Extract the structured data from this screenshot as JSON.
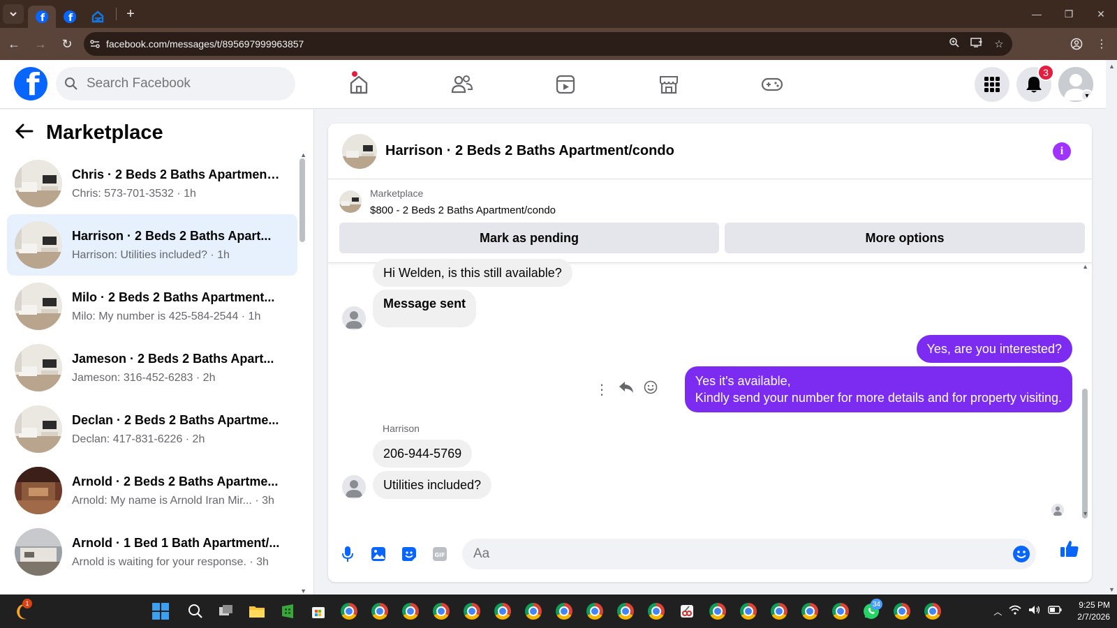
{
  "browser": {
    "tabs": [
      {
        "name": "facebook-tab-1",
        "active": true
      },
      {
        "name": "facebook-tab-2",
        "active": false
      },
      {
        "name": "zillow-tab",
        "active": false
      }
    ],
    "url": "facebook.com/messages/t/895697999963857"
  },
  "fb_header": {
    "search_placeholder": "Search Facebook",
    "notification_count": "3"
  },
  "left_panel": {
    "title": "Marketplace",
    "conversations": [
      {
        "name": "Chris · 2 Beds 2 Baths Apartment...",
        "preview": "Chris: 573-701-3532 · 1h",
        "active": false
      },
      {
        "name": "Harrison · 2 Beds 2 Baths Apart...",
        "preview": "Harrison: Utilities included? · 1h",
        "active": true
      },
      {
        "name": "Milo · 2 Beds 2 Baths Apartment...",
        "preview": "Milo: My number is 425-584-2544 · 1h",
        "active": false
      },
      {
        "name": "Jameson · 2 Beds 2 Baths Apart...",
        "preview": "Jameson: 316-452-6283 · 2h",
        "active": false
      },
      {
        "name": "Declan · 2 Beds 2 Baths Apartme...",
        "preview": "Declan: 417-831-6226 · 2h",
        "active": false
      },
      {
        "name": "Arnold · 2 Beds 2 Baths Apartme...",
        "preview": "Arnold: My name is Arnold Iran Mir...  · 3h",
        "active": false
      },
      {
        "name": "Arnold · 1 Bed 1 Bath Apartment/...",
        "preview": "Arnold is waiting for your response. · 3h",
        "active": false
      }
    ]
  },
  "chat": {
    "title": "Harrison · 2 Beds 2 Baths Apartment/condo",
    "marketplace_label": "Marketplace",
    "listing": "$800 - 2 Beds 2 Baths Apartment/condo",
    "mark_pending_label": "Mark as pending",
    "more_options_label": "More options",
    "messages": {
      "m1": "Hi Welden, is this still available?",
      "m2": "Message sent",
      "m3": "Yes, are you interested?",
      "m4_line1": "Yes it's available,",
      "m4_line2": "Kindly send your number for more details and for property visiting.",
      "sender": "Harrison",
      "m5": "206-944-5769",
      "m6": "Utilities included?"
    },
    "composer_placeholder": "Aa"
  },
  "taskbar": {
    "weather_badge": "1",
    "whatsapp_badge": "34",
    "time": "9:25 PM",
    "date": "2/7/2026"
  },
  "colors": {
    "fb_blue": "#0866ff",
    "outgoing_bubble": "#7b2cf0",
    "active_convo": "#e7f1fe",
    "info_icon": "#a033ff"
  }
}
